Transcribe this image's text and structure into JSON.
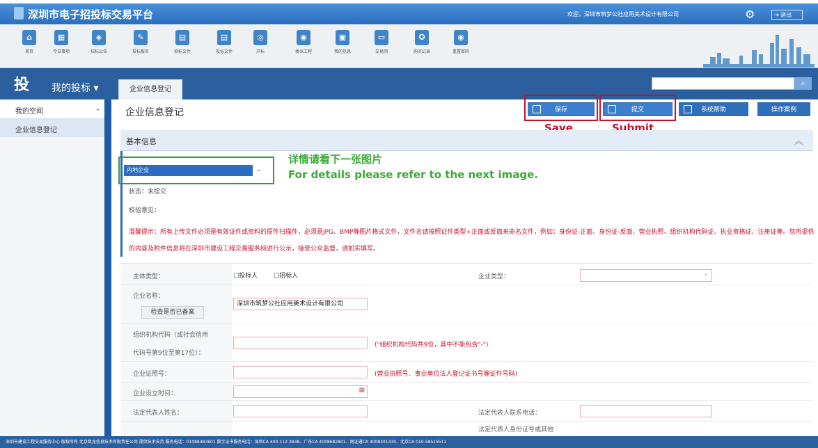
{
  "header": {
    "title": "深圳市电子招投标交易平台",
    "welcome": "欢迎，深圳市筑梦公社应用美术设计有限公司",
    "exit_label": "退出"
  },
  "toolbar": [
    {
      "label": "首页",
      "icon": "home-icon"
    },
    {
      "label": "今日事项",
      "icon": "calendar-icon"
    },
    {
      "label": "招标公告",
      "icon": "notice-icon"
    },
    {
      "label": "投标报名",
      "icon": "edit-icon"
    },
    {
      "label": "招标文件",
      "icon": "file-icon"
    },
    {
      "label": "投标文件",
      "icon": "file-icon"
    },
    {
      "label": "开标",
      "icon": "target-icon"
    },
    {
      "label": "类似工程",
      "icon": "location-icon"
    },
    {
      "label": "我的信息",
      "icon": "id-card-icon"
    },
    {
      "label": "交易网",
      "icon": "monitor-icon"
    },
    {
      "label": "购买记录",
      "icon": "medal-icon"
    },
    {
      "label": "重置密码",
      "icon": "location-icon"
    }
  ],
  "nav": {
    "big": "投",
    "mine": "我的投标",
    "tab": "企业信息登记"
  },
  "sidebar": {
    "head": "我的空间",
    "item": "企业信息登记"
  },
  "page": {
    "title": "企业信息登记",
    "save": "保存",
    "submit": "提交",
    "help": "系统帮助",
    "case": "操作案例",
    "save_en": "Save",
    "submit_en": "Submit",
    "section": "基本信息",
    "dropdown": "内地企业",
    "note_zh": "详情请看下一张图片",
    "note_en": "For details please refer to the next image.",
    "status": "状态：未提交",
    "verify": "校验意见：",
    "tip": "温馨提示：所有上传文件必须是有效证件或资料的原件扫描件，必须是JPG、BMP等图片格式文件，文件名请按照证件类型+正面或反面来命名文件，例如：身份证-正面、身份证-反面、营业执照、组织机构代码证、执业资格证、注册证等。您所提供的内容及附件信息将在深圳市建设工程交易服务网进行公示，接受公众监督，请如实填写。"
  },
  "form": {
    "subject_type": "主体类型：",
    "bidder": "☐投标人",
    "tenderer": "☐招标人",
    "company_type": "企业类型：",
    "company_name": "企业名称：",
    "check_btn": "检查是否已备案",
    "company_value": "深圳市筑梦公社应用美术设计有限公司",
    "org_code_1": "组织机构代码（或社会信用",
    "org_code_2": "代码号第9位至第17位）：",
    "org_hint": "(\"组织机构代码共9位，其中不能包含\"-\")",
    "cert_no": "企业证照号：",
    "cert_hint": "(营业执照号、事业单位法人登记证书号等证件号码)",
    "est_date": "企业设立时间：",
    "legal_name": "法定代表人姓名：",
    "legal_phone": "法定代表人联系电话：",
    "legal_id": "法定代表人身份证号或其他"
  },
  "footer": "深圳市建设工程交易服务中心 版权所有    北京筑龙信息技术有限责任公司 提供技术支持    服务电话：01088483801    数字证书服务电话：深圳CA 400-112-3838、广东CA 4008682801、网证通CA 4008301330、北京CA 010-58515511",
  "colors": {
    "topbar": "#2a6fc0",
    "accent": "#2b6ab8",
    "highlight_red": "#c8112b",
    "highlight_green": "#3aaa35"
  }
}
